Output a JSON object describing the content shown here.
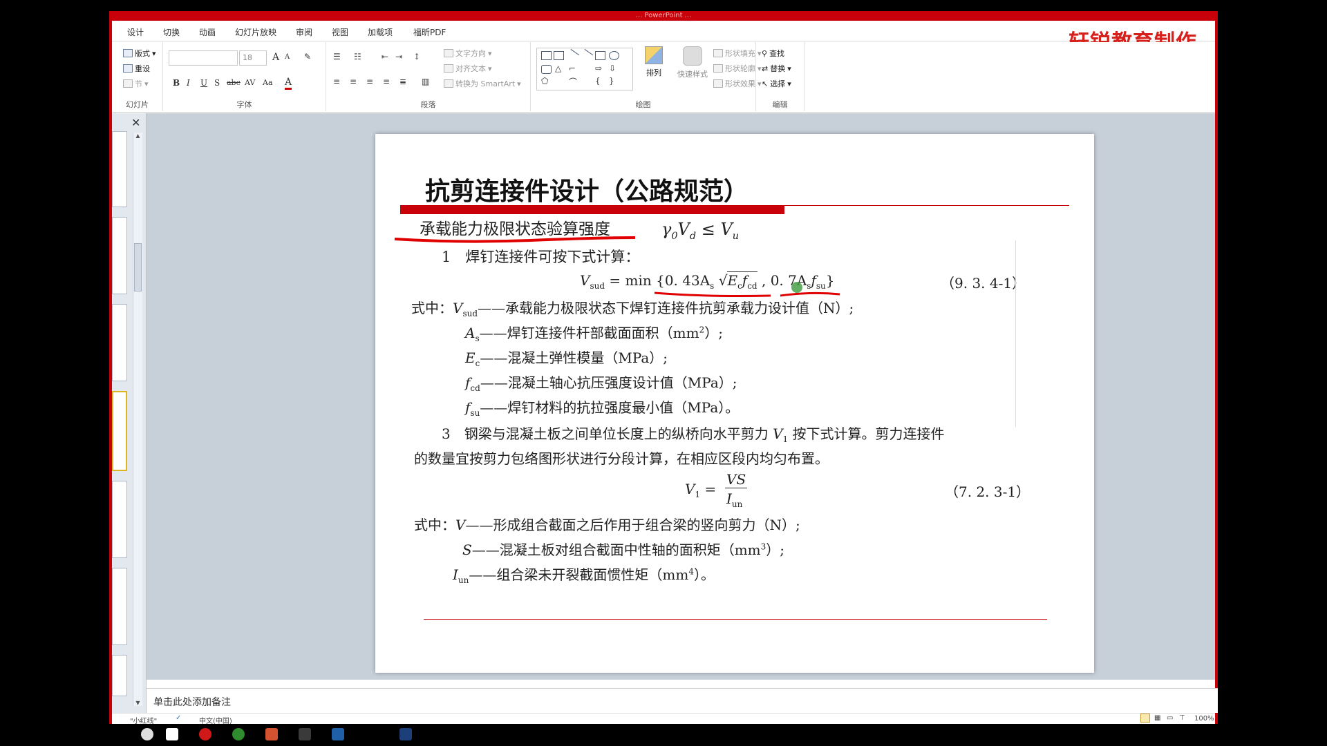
{
  "window": {
    "title": "... PowerPoint ..."
  },
  "ribbon_tabs": [
    "设计",
    "切换",
    "动画",
    "幻灯片放映",
    "审阅",
    "视图",
    "加载项",
    "福昕PDF"
  ],
  "brand": "轩锐教育制作",
  "ribbon": {
    "slides_group": {
      "layout": "版式",
      "reset": "重设",
      "section": "节",
      "label": "幻灯片"
    },
    "font_group": {
      "size": "18",
      "label": "字体",
      "bold": "B",
      "italic": "I",
      "underline": "U",
      "shadow": "S",
      "strike": "abc",
      "spacing": "AV",
      "case": "Aa",
      "color": "A",
      "grow": "A",
      "shrink": "A"
    },
    "para_group": {
      "text_dir": "文字方向",
      "align_text": "对齐文本",
      "smartart": "转换为 SmartArt",
      "label": "段落"
    },
    "draw_group": {
      "arrange": "排列",
      "quick_styles": "快速样式",
      "fill": "形状填充",
      "outline": "形状轮廓",
      "effects": "形状效果",
      "label": "绘图"
    },
    "edit_group": {
      "find": "查找",
      "replace": "替换",
      "select": "选择",
      "label": "编辑"
    }
  },
  "slide": {
    "title": "抗剪连接件设计（公路规范）",
    "subtitle": "承载能力极限状态验算强度",
    "inequality": {
      "gamma": "γ",
      "zero": "0",
      "v": "V",
      "d": "d",
      "le": " ≤ ",
      "u": "u"
    },
    "item1": "1　焊钉连接件可按下式计算：",
    "formula1": {
      "lhs": "V",
      "lhs_sub": "sud",
      "eq": " = min ",
      "part1": "{0. 43A",
      "as_sub": "s",
      "ec": "E",
      "ec_sub": "c",
      "fcd": "f",
      "fcd_sub": "cd",
      "comma": " ,  ",
      "part2": "0. 7A",
      "fsu": "f",
      "fsu_sub": "su",
      "close": "}",
      "number": "（9. 3. 4-1）"
    },
    "where1": {
      "lead": "式中：",
      "sym": "V",
      "sub": "sud",
      "text": "——承载能力极限状态下焊钉连接件抗剪承载力设计值（N）;"
    },
    "defs1": [
      {
        "sym": "A",
        "sub": "s",
        "text": "——焊钉连接件杆部截面面积（mm",
        "sup": "2",
        "tail": "）;"
      },
      {
        "sym": "E",
        "sub": "c",
        "text": "——混凝土弹性模量（MPa）;",
        "sup": "",
        "tail": ""
      },
      {
        "sym": "f",
        "sub": "cd",
        "text": "——混凝土轴心抗压强度设计值（MPa）;",
        "sup": "",
        "tail": ""
      },
      {
        "sym": "f",
        "sub": "su",
        "text": "——焊钉材料的抗拉强度最小值（MPa）。",
        "sup": "",
        "tail": ""
      }
    ],
    "item3_line1": {
      "pre": "3　钢梁与混凝土板之间单位长度上的纵桥向水平剪力 ",
      "sym": "V",
      "sub": "1",
      "post": " 按下式计算。剪力连接件"
    },
    "item3_line2": "的数量宜按剪力包络图形状进行分段计算，在相应区段内均匀布置。",
    "formula2": {
      "lhs": "V",
      "lhs_sub": "1",
      "eq": " = ",
      "num": "VS",
      "den": "I",
      "den_sub": "un",
      "number": "（7. 2. 3-1）"
    },
    "where2": {
      "lead": "式中：",
      "sym": "V",
      "text": "——形成组合截面之后作用于组合梁的竖向剪力（N）;"
    },
    "defs2": [
      {
        "sym": "S",
        "sub": "",
        "text": "——混凝土板对组合截面中性轴的面积矩（mm",
        "sup": "3",
        "tail": "）;"
      },
      {
        "sym": "I",
        "sub": "un",
        "text": "——组合梁未开裂截面惯性矩（mm",
        "sup": "4",
        "tail": "）。"
      }
    ]
  },
  "notes": {
    "placeholder": "单击此处添加备注"
  },
  "status": {
    "theme": "\"小红线\"",
    "language": "中文(中国)",
    "zoom": "100%"
  },
  "colors": {
    "accent_red": "#c8000a",
    "brand_red": "#d6201b",
    "annotation_red": "#e00000"
  }
}
